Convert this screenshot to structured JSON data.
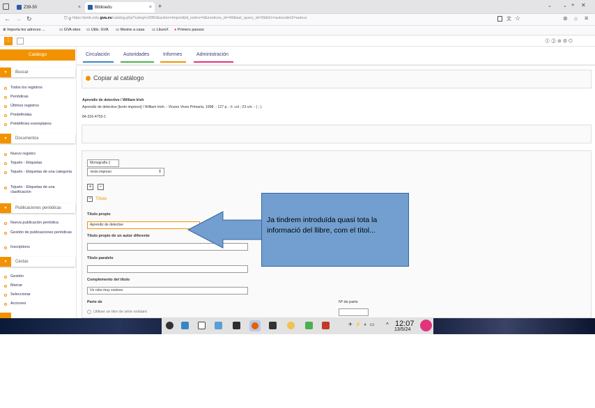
{
  "browser": {
    "tabs": [
      {
        "label": "Z39-50"
      },
      {
        "label": "Biblioedu"
      }
    ],
    "new_tab": "+",
    "url_prefix": "https://pmb.edu.",
    "url_domain": "gva.es",
    "url_rest": "/catalog.php?categ=z3950&action=import&id_notice=0&znotices_id=49&last_query_id=39&tri1=auteur&tri2=auteur",
    "bookmarks": [
      "Importa les adreces ...",
      "GVA sites",
      "Utils. GVA",
      "Mestre a casa",
      "LliureX",
      "Primers passos"
    ]
  },
  "sidebar": {
    "title": "Catálogo",
    "sections": [
      {
        "label": "Buscar",
        "items": [
          "Todos los registros",
          "Periódicas",
          "Últimos registros",
          "Predefinidas",
          "Prédéfinies exemplaires"
        ]
      },
      {
        "label": "Documentos",
        "items": [
          "Nuevo registro",
          "Tejuelo - Etiquetas",
          "Tejuelo - Etiquetas de una categoría",
          "Tejuelo - Etiquetas de una clasificación"
        ]
      },
      {
        "label": "Publicaciones periódicas",
        "items": [
          "Nueva publicación periódica",
          "Gestión de publicaciones periódicas",
          "Inscriptions"
        ]
      },
      {
        "label": "Cestas",
        "items": [
          "Gestión",
          "Marcar",
          "Seleccionar",
          "Acciones"
        ]
      }
    ]
  },
  "menu": {
    "items": [
      "Circulación",
      "Autoridades",
      "Informes",
      "Administración"
    ],
    "underline_colors": [
      "#3a85c6",
      "#4caf50",
      "#f39200",
      "#e0357a"
    ]
  },
  "main": {
    "heading": "Copiar al catálogo",
    "record_title": "Aprendiz de detective / William Irish",
    "record_desc": "Aprendiz de detective [texto impreso] / William Irish. - Vicens Vives Primaria, 1998. - 127 p. : il. col ; 23 cm. - ( ; ).",
    "isbn": "84-316-4753-1",
    "doc_type_select": "Monografía ‡",
    "doc_format_select": "texto impreso",
    "section_title": "Título",
    "fields": [
      {
        "label": "Título propio",
        "value": "Aprendiz de detective"
      },
      {
        "label": "Título propio de un autor diferente",
        "value": ""
      },
      {
        "label": "Título paralelo",
        "value": ""
      },
      {
        "label": "Complemento del título",
        "value": "Un robo muy costoso"
      }
    ],
    "part_of_label": "Parte de",
    "part_number_label": "Nº de parte",
    "serie_option": "Utiliser un titre de série existant"
  },
  "callout": {
    "text": "Ja tindrem introduïda quasi tota la informació del llibre, com el títol..."
  },
  "taskbar": {
    "time": "12:07",
    "date": "13/5/24",
    "tray_caret": "^"
  },
  "colors": {
    "accent": "#f39200",
    "callout_fill": "#729fcf",
    "callout_border": "#3465a4"
  }
}
